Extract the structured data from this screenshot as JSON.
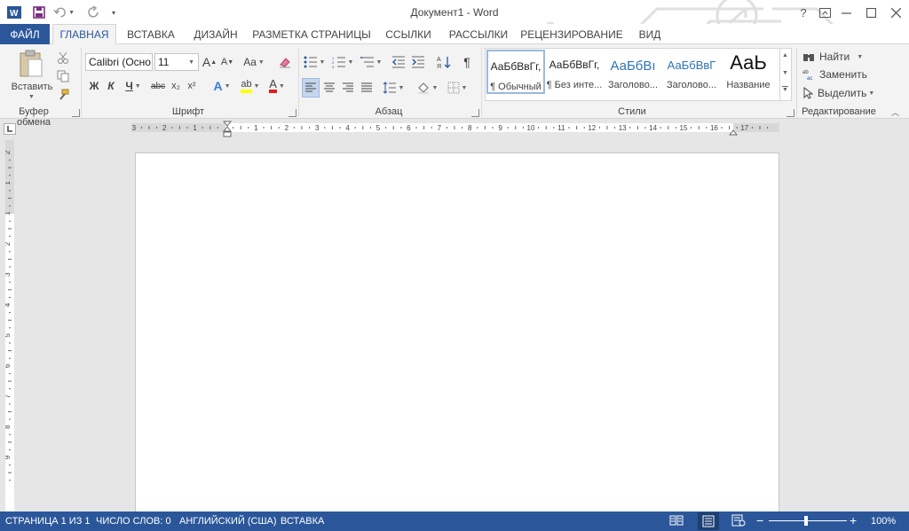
{
  "app": {
    "title": "Документ1 - Word",
    "accent": "#2b579a"
  },
  "qat": {
    "word_icon": "word-app-icon",
    "save_icon": "save-icon",
    "undo_icon": "undo-icon",
    "redo_icon": "redo-icon",
    "customize_icon": "customize-qat-icon"
  },
  "window": {
    "help": "?",
    "restore_ribbon_icon": "ribbon-display-icon",
    "minimize_icon": "minimize-icon",
    "maximize_icon": "maximize-icon",
    "close_icon": "close-icon"
  },
  "tabs": {
    "file": "ФАЙЛ",
    "home": "ГЛАВНАЯ",
    "insert": "ВСТАВКА",
    "design": "ДИЗАЙН",
    "layout": "РАЗМЕТКА СТРАНИЦЫ",
    "references": "ССЫЛКИ",
    "mailings": "РАССЫЛКИ",
    "review": "РЕЦЕНЗИРОВАНИЕ",
    "view": "ВИД"
  },
  "clipboard": {
    "paste": "Вставить",
    "label": "Буфер обмена"
  },
  "font": {
    "name": "Calibri (Осно",
    "size": "11",
    "label": "Шрифт",
    "bold": "Ж",
    "italic": "К",
    "underline": "Ч",
    "strike": "abc",
    "sub": "x₂",
    "sup": "x²",
    "grow": "A",
    "shrink": "A",
    "case": "Aa",
    "effects": "A",
    "highlight": "ab",
    "color": "A",
    "highlight_color": "#ffff00",
    "font_color": "#e01d1d"
  },
  "paragraph": {
    "label": "Абзац",
    "pilcrow": "¶"
  },
  "styles": {
    "label": "Стили",
    "items": [
      {
        "sample": "АаБбВвГг,",
        "name": "¶ Обычный"
      },
      {
        "sample": "АаБбВвГг,",
        "name": "¶ Без инте..."
      },
      {
        "sample": "АаБбВı",
        "name": "Заголово..."
      },
      {
        "sample": "АаБбВвГ",
        "name": "Заголово..."
      },
      {
        "sample": "АаЬ",
        "name": "Название"
      }
    ],
    "heading_color": "#2e74b5"
  },
  "editing": {
    "label": "Редактирование",
    "find": "Найти",
    "replace": "Заменить",
    "select": "Выделить"
  },
  "ruler": {
    "numbers_left": [
      "3",
      "2",
      "1"
    ],
    "numbers": [
      "1",
      "2",
      "3",
      "4",
      "5",
      "6",
      "7",
      "8",
      "9",
      "10",
      "11",
      "12",
      "13",
      "14",
      "15",
      "16",
      "17"
    ],
    "vertical_numbers": [
      "2",
      "1",
      "1",
      "2",
      "3",
      "4",
      "5",
      "6",
      "7",
      "8",
      "9"
    ]
  },
  "status": {
    "page": "СТРАНИЦА 1 ИЗ 1",
    "words": "ЧИСЛО СЛОВ: 0",
    "language": "АНГЛИЙСКИЙ (США)",
    "mode": "ВСТАВКА",
    "zoom": "100%",
    "zoom_minus": "−",
    "zoom_plus": "+"
  }
}
